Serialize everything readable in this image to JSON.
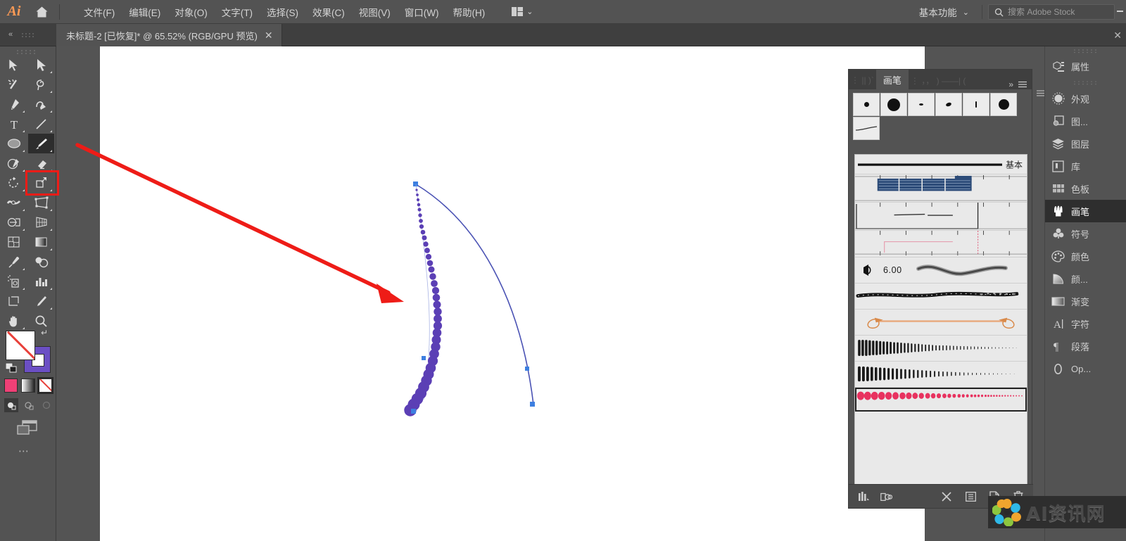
{
  "app": {
    "name": "Adobe Illustrator",
    "logo_text": "Ai",
    "accent_color": "#ff9a55",
    "ui_bg": "#535353"
  },
  "menubar": {
    "home_icon": "home-icon",
    "items": [
      {
        "label": "文件(F)"
      },
      {
        "label": "编辑(E)"
      },
      {
        "label": "对象(O)"
      },
      {
        "label": "文字(T)"
      },
      {
        "label": "选择(S)"
      },
      {
        "label": "效果(C)"
      },
      {
        "label": "视图(V)"
      },
      {
        "label": "窗口(W)"
      },
      {
        "label": "帮助(H)"
      }
    ],
    "arrange_icon": "arrange-documents-icon",
    "arrange_caret": "⌄",
    "workspace": {
      "label": "基本功能",
      "caret": "⌄"
    },
    "search": {
      "icon": "search-icon",
      "placeholder": "搜索 Adobe Stock",
      "value": ""
    }
  },
  "tabbar": {
    "collapse_icon": "collapse-left-icon",
    "document": {
      "title": "未标题-2 [已恢复]* @ 65.52% (RGB/GPU 预览)",
      "close": "✕"
    },
    "window_close": "✕"
  },
  "tools": {
    "rows": [
      [
        {
          "name": "selection-tool",
          "icon": "arrow-solid",
          "selected": false
        },
        {
          "name": "direct-selection-tool",
          "icon": "arrow-white",
          "selected": false
        }
      ],
      [
        {
          "name": "magic-wand-tool",
          "icon": "magic-wand",
          "selected": false
        },
        {
          "name": "lasso-tool",
          "icon": "lasso",
          "selected": false
        }
      ],
      [
        {
          "name": "pen-tool",
          "icon": "pen",
          "selected": false
        },
        {
          "name": "curvature-tool",
          "icon": "curvature",
          "selected": false
        }
      ],
      [
        {
          "name": "type-tool",
          "icon": "type-T",
          "selected": false
        },
        {
          "name": "line-segment-tool",
          "icon": "line-segment",
          "selected": false
        }
      ],
      [
        {
          "name": "ellipse-tool",
          "icon": "ellipse",
          "selected": false
        },
        {
          "name": "paintbrush-tool",
          "icon": "paintbrush",
          "selected": true
        }
      ],
      [
        {
          "name": "shaper-tool",
          "icon": "shaper-pencil",
          "selected": false
        },
        {
          "name": "eraser-tool",
          "icon": "eraser",
          "selected": false
        }
      ],
      [
        {
          "name": "rotate-tool",
          "icon": "rotate",
          "selected": false
        },
        {
          "name": "scale-tool",
          "icon": "scale",
          "selected": false
        }
      ],
      [
        {
          "name": "width-tool",
          "icon": "width",
          "selected": false
        },
        {
          "name": "free-transform-tool",
          "icon": "free-transform",
          "selected": false
        }
      ],
      [
        {
          "name": "shape-builder-tool",
          "icon": "shape-builder",
          "selected": false
        },
        {
          "name": "perspective-grid-tool",
          "icon": "perspective-grid",
          "selected": false
        }
      ],
      [
        {
          "name": "mesh-tool",
          "icon": "mesh",
          "selected": false
        },
        {
          "name": "gradient-tool",
          "icon": "gradient",
          "selected": false
        }
      ],
      [
        {
          "name": "eyedropper-tool",
          "icon": "eyedropper",
          "selected": false
        },
        {
          "name": "blend-tool",
          "icon": "blend",
          "selected": false
        }
      ],
      [
        {
          "name": "symbol-sprayer-tool",
          "icon": "symbol-sprayer",
          "selected": false
        },
        {
          "name": "column-graph-tool",
          "icon": "bar-graph",
          "selected": false
        }
      ],
      [
        {
          "name": "artboard-tool",
          "icon": "artboard",
          "selected": false
        },
        {
          "name": "slice-tool",
          "icon": "slice-knife",
          "selected": false
        }
      ],
      [
        {
          "name": "hand-tool",
          "icon": "hand",
          "selected": false
        },
        {
          "name": "zoom-tool",
          "icon": "magnifier",
          "selected": false
        }
      ]
    ],
    "highlight": {
      "name": "paintbrush-tool-highlight",
      "color": "#ee1c17"
    },
    "fill": {
      "name": "fill-swatch",
      "value": "none",
      "color": "#ffffff"
    },
    "stroke": {
      "name": "stroke-swatch",
      "color": "#6b4fc4"
    },
    "swap_icon": "swap-fill-stroke-icon",
    "default_icon": "default-fill-stroke-icon",
    "paint_modes": [
      {
        "name": "color-mode",
        "color": "#ef4076",
        "active": false
      },
      {
        "name": "gradient-mode",
        "color": "#bdbdbd",
        "active": false
      },
      {
        "name": "none-mode",
        "color": "#ffffff",
        "active": true
      }
    ],
    "draw_modes": [
      {
        "name": "draw-normal",
        "active": true
      },
      {
        "name": "draw-behind",
        "active": false
      },
      {
        "name": "draw-inside",
        "active": false
      }
    ],
    "screen_mode_icon": "change-screen-mode-icon",
    "more_tools": "⋯"
  },
  "canvas": {
    "artboard_bg": "#ffffff",
    "objects": [
      {
        "name": "beaded-brush-path",
        "stroke_color": "#5b3fb5",
        "description": "曲线画笔描边（圆点画笔）"
      },
      {
        "name": "plain-curve-path",
        "stroke_color": "#4a52b4",
        "description": "基本描边曲线"
      }
    ],
    "annotation": {
      "name": "red-arrow-annotation",
      "color": "#ee1c17"
    }
  },
  "brush_panel": {
    "tabs": [
      {
        "label": "画笔",
        "active": true
      }
    ],
    "overflow": "»",
    "menu_icon": "panel-menu-icon",
    "presets": {
      "row1": [
        {
          "name": "preset-brush-1",
          "size": 7
        },
        {
          "name": "preset-brush-2",
          "size": 18
        },
        {
          "name": "preset-brush-3",
          "size": 5
        },
        {
          "name": "preset-brush-4",
          "size": 7
        },
        {
          "name": "preset-brush-5",
          "size": 3
        },
        {
          "name": "preset-brush-6",
          "size": 15
        }
      ],
      "row2": [
        {
          "name": "preset-brush-7",
          "icon": "tapered-stroke"
        }
      ]
    },
    "brushes": [
      {
        "name": "brush-basic",
        "label": "基本",
        "type": "plain-line",
        "selected": false
      },
      {
        "name": "brush-glitch-1",
        "label": "",
        "type": "glitch-blue",
        "selected": false
      },
      {
        "name": "brush-glitch-2",
        "label": "",
        "type": "glitch-thin",
        "selected": false
      },
      {
        "name": "brush-glitch-3",
        "label": "",
        "type": "glitch-pink",
        "selected": false
      },
      {
        "name": "brush-charcoal",
        "label": "6.00",
        "type": "charcoal-wave",
        "selected": false
      },
      {
        "name": "brush-dry-ink",
        "label": "",
        "type": "dry-ink",
        "selected": false
      },
      {
        "name": "brush-arrow-ribbon",
        "label": "",
        "type": "arrow-ribbon",
        "selected": false
      },
      {
        "name": "brush-fur-1",
        "label": "",
        "type": "fur-dense",
        "selected": false
      },
      {
        "name": "brush-fur-2",
        "label": "",
        "type": "fur-dense-2",
        "selected": false
      },
      {
        "name": "brush-pink-dots",
        "label": "",
        "type": "pink-dots",
        "selected": true
      }
    ],
    "bottom_bar": [
      {
        "name": "brush-libraries-menu-icon",
        "icon": "libraries-stack"
      },
      {
        "name": "libraries-panel-icon",
        "icon": "cc-libraries"
      },
      {
        "name": "remove-brush-stroke-icon",
        "icon": "x-brush"
      },
      {
        "name": "brush-options-icon",
        "icon": "options"
      },
      {
        "name": "new-brush-icon",
        "icon": "new-page"
      },
      {
        "name": "delete-brush-icon",
        "icon": "trash"
      }
    ]
  },
  "dock": {
    "groups": [
      {
        "items": [
          {
            "label": "属性",
            "icon": "properties-icon",
            "active": false,
            "name": "dock-item-properties"
          }
        ]
      },
      {
        "items": [
          {
            "label": "外观",
            "icon": "appearance-icon",
            "active": false,
            "name": "dock-item-appearance"
          },
          {
            "label": "图...",
            "icon": "graphic-styles-icon",
            "active": false,
            "name": "dock-item-graphic-styles"
          },
          {
            "label": "图层",
            "icon": "layers-icon",
            "active": false,
            "name": "dock-item-layers"
          },
          {
            "label": "库",
            "icon": "libraries-icon",
            "active": false,
            "name": "dock-item-libraries"
          },
          {
            "label": "色板",
            "icon": "swatches-icon",
            "active": false,
            "name": "dock-item-swatches"
          },
          {
            "label": "画笔",
            "icon": "brushes-icon",
            "active": true,
            "name": "dock-item-brushes"
          },
          {
            "label": "符号",
            "icon": "symbols-icon",
            "active": false,
            "name": "dock-item-symbols"
          },
          {
            "label": "颜色",
            "icon": "color-icon",
            "active": false,
            "name": "dock-item-color"
          },
          {
            "label": "颜...",
            "icon": "color-guide-icon",
            "active": false,
            "name": "dock-item-color-guide"
          },
          {
            "label": "渐变",
            "icon": "gradient-icon",
            "active": false,
            "name": "dock-item-gradient"
          },
          {
            "label": "字符",
            "icon": "character-icon",
            "active": false,
            "name": "dock-item-character"
          },
          {
            "label": "段落",
            "icon": "paragraph-icon",
            "active": false,
            "name": "dock-item-paragraph"
          },
          {
            "label": "Op...",
            "icon": "opacity-icon",
            "active": false,
            "name": "dock-item-opacity"
          }
        ]
      }
    ]
  },
  "watermark": {
    "text": "AI资讯网",
    "logo": "flower-logo"
  }
}
